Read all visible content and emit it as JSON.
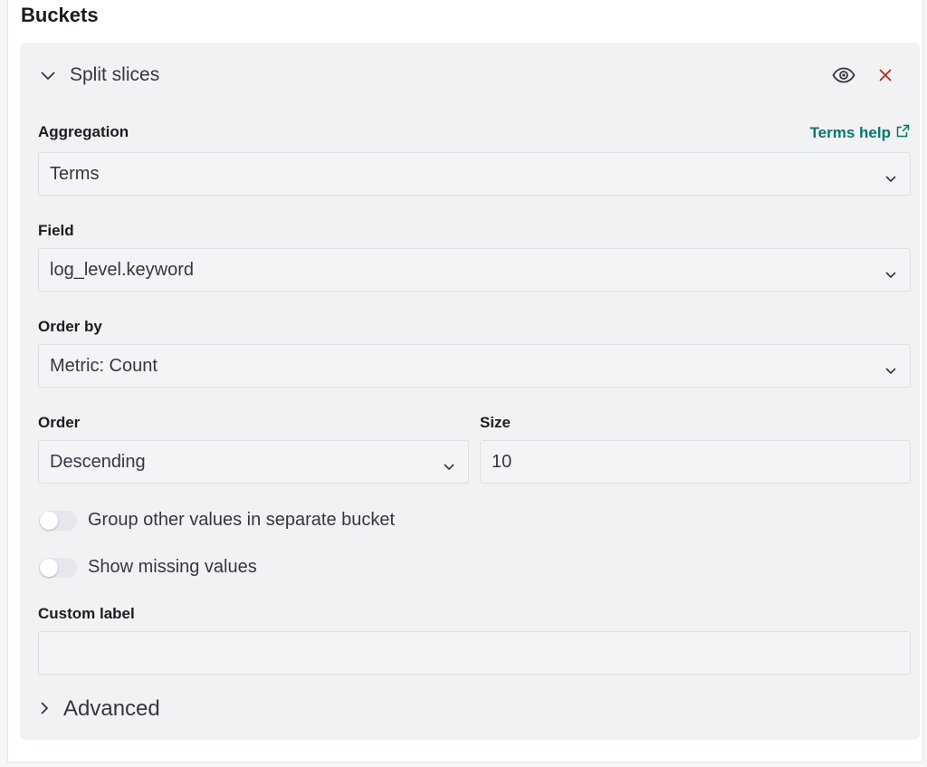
{
  "buckets_title": "Buckets",
  "accordion": {
    "title": "Split slices",
    "toggle_icon": "chevron-down-icon",
    "visibility_icon": "eye-icon",
    "remove_icon": "close-icon"
  },
  "aggregation": {
    "label": "Aggregation",
    "help_link": "Terms help",
    "help_icon": "external-link-icon",
    "value": "Terms"
  },
  "field": {
    "label": "Field",
    "value": "log_level.keyword"
  },
  "order_by": {
    "label": "Order by",
    "value": "Metric: Count"
  },
  "order": {
    "label": "Order",
    "value": "Descending"
  },
  "size": {
    "label": "Size",
    "value": "10"
  },
  "toggles": {
    "group_other": {
      "label": "Group other values in separate bucket",
      "on": false
    },
    "show_missing": {
      "label": "Show missing values",
      "on": false
    }
  },
  "custom_label": {
    "label": "Custom label",
    "value": ""
  },
  "advanced": {
    "label": "Advanced"
  },
  "colors": {
    "accent_link": "#07776b",
    "remove_red": "#bd271e",
    "panel_bg": "#f1f2f4"
  }
}
